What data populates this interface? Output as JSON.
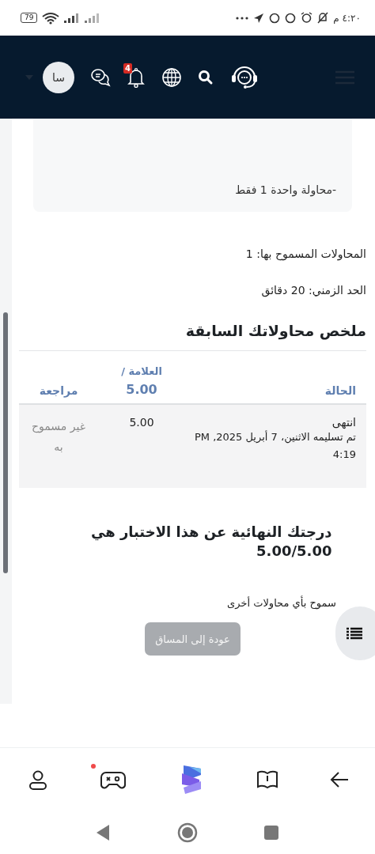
{
  "status_bar": {
    "time": "٤:٢٠ م",
    "battery": "79"
  },
  "header": {
    "notification_count": "4",
    "avatar_initials": "سا"
  },
  "info_card": {
    "text": "-محاولة واحدة 1 فقط"
  },
  "details": [
    "المحاولات المسموح بها: 1",
    "الحد الزمني: 20 دقائق"
  ],
  "summary": {
    "heading": "ملخص محاولاتك السابقة",
    "columns": [
      {
        "label": "الحالة"
      },
      {
        "label": "العلامة /",
        "max": "5.00"
      },
      {
        "label": "مراجعة"
      }
    ],
    "rows": [
      {
        "status": "انتهى",
        "submitted": "تم تسليمه الاثنين، 7 أبريل 2025, PM 4:19",
        "grade": "5.00",
        "review": "غير مسموح به"
      }
    ]
  },
  "final_grade": "درجتك النهائية عن هذا الاختبار هي 5.00/5.00",
  "no_more_attempts": "سموح بأي محاولات أخرى",
  "back_button": {
    "label": "عودة إلى المساق",
    "disabled": true
  },
  "bottom_nav": [
    {
      "kind": "profile",
      "dot": false
    },
    {
      "kind": "games",
      "dot": true
    },
    {
      "kind": "logo",
      "dot": false
    },
    {
      "kind": "book",
      "dot": false
    },
    {
      "kind": "back",
      "dot": false
    }
  ]
}
